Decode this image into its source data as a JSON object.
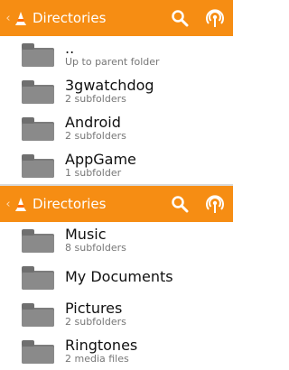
{
  "accent": "#f68d13",
  "top_panel": {
    "app_title": "Directories",
    "items": [
      {
        "name": "..",
        "sub": "Up to parent folder"
      },
      {
        "name": "3gwatchdog",
        "sub": "2 subfolders"
      },
      {
        "name": "Android",
        "sub": "2 subfolders"
      },
      {
        "name": "AppGame",
        "sub": "1 subfolder"
      }
    ]
  },
  "bottom_panel": {
    "app_title": "Directories",
    "items": [
      {
        "name": "Music",
        "sub": "8 subfolders"
      },
      {
        "name": "My Documents",
        "sub": ""
      },
      {
        "name": "Pictures",
        "sub": "2 subfolders"
      },
      {
        "name": "Ringtones",
        "sub": "2 media files"
      }
    ]
  }
}
